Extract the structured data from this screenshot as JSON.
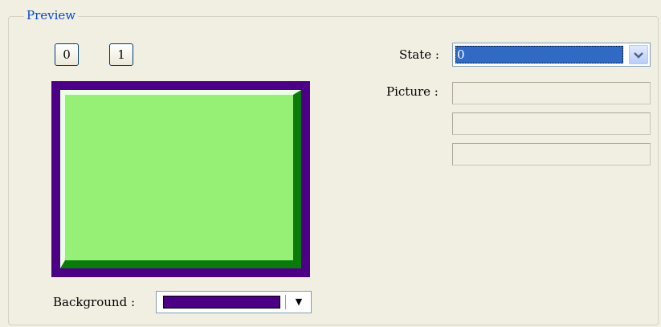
{
  "preview_group": {
    "title": "Preview",
    "state_buttons": [
      "0",
      "1"
    ],
    "background": {
      "label": "Background :",
      "color": "#4b0085"
    },
    "shape": {
      "frame_color": "#4b0085",
      "face_color": "#95f075",
      "highlight_color": "#ecffe4",
      "shadow_color": "#0a7a0a"
    }
  },
  "state": {
    "label": "State :",
    "selected_value": "0",
    "icon": "chevron-down-icon"
  },
  "picture": {
    "label": "Picture :",
    "fields": [
      "",
      "",
      ""
    ]
  }
}
